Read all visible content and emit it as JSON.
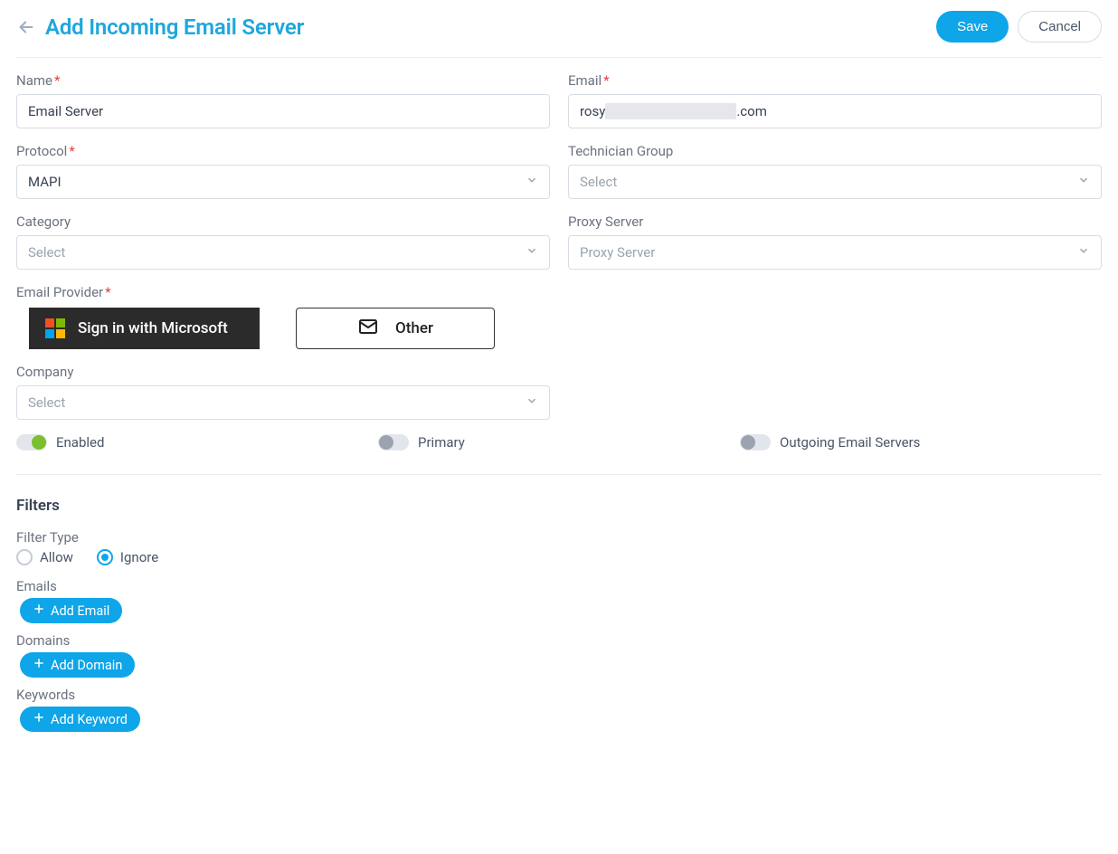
{
  "header": {
    "title": "Add Incoming Email Server",
    "save": "Save",
    "cancel": "Cancel"
  },
  "fields": {
    "name": {
      "label": "Name",
      "value": "Email Server"
    },
    "email": {
      "label": "Email",
      "prefix": "rosy",
      "suffix": ".com"
    },
    "protocol": {
      "label": "Protocol",
      "value": "MAPI"
    },
    "tech_group": {
      "label": "Technician Group",
      "placeholder": "Select"
    },
    "category": {
      "label": "Category",
      "placeholder": "Select"
    },
    "proxy": {
      "label": "Proxy Server",
      "placeholder": "Proxy Server"
    },
    "provider": {
      "label": "Email Provider",
      "ms": "Sign in with Microsoft",
      "other": "Other"
    },
    "company": {
      "label": "Company",
      "placeholder": "Select"
    }
  },
  "toggles": {
    "enabled": "Enabled",
    "primary": "Primary",
    "outgoing": "Outgoing Email Servers"
  },
  "filters": {
    "title": "Filters",
    "type_label": "Filter Type",
    "allow": "Allow",
    "ignore": "Ignore",
    "emails_label": "Emails",
    "add_email": "Add Email",
    "domains_label": "Domains",
    "add_domain": "Add Domain",
    "keywords_label": "Keywords",
    "add_keyword": "Add Keyword"
  }
}
